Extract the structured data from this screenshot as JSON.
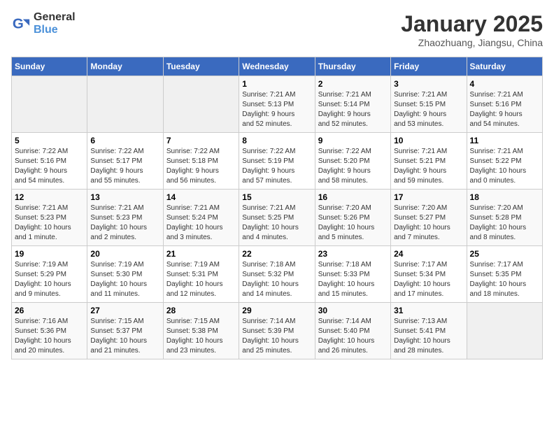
{
  "logo": {
    "line1": "General",
    "line2": "Blue"
  },
  "title": "January 2025",
  "subtitle": "Zhaozhuang, Jiangsu, China",
  "days_of_week": [
    "Sunday",
    "Monday",
    "Tuesday",
    "Wednesday",
    "Thursday",
    "Friday",
    "Saturday"
  ],
  "weeks": [
    [
      {
        "num": "",
        "info": ""
      },
      {
        "num": "",
        "info": ""
      },
      {
        "num": "",
        "info": ""
      },
      {
        "num": "1",
        "info": "Sunrise: 7:21 AM\nSunset: 5:13 PM\nDaylight: 9 hours\nand 52 minutes."
      },
      {
        "num": "2",
        "info": "Sunrise: 7:21 AM\nSunset: 5:14 PM\nDaylight: 9 hours\nand 52 minutes."
      },
      {
        "num": "3",
        "info": "Sunrise: 7:21 AM\nSunset: 5:15 PM\nDaylight: 9 hours\nand 53 minutes."
      },
      {
        "num": "4",
        "info": "Sunrise: 7:21 AM\nSunset: 5:16 PM\nDaylight: 9 hours\nand 54 minutes."
      }
    ],
    [
      {
        "num": "5",
        "info": "Sunrise: 7:22 AM\nSunset: 5:16 PM\nDaylight: 9 hours\nand 54 minutes."
      },
      {
        "num": "6",
        "info": "Sunrise: 7:22 AM\nSunset: 5:17 PM\nDaylight: 9 hours\nand 55 minutes."
      },
      {
        "num": "7",
        "info": "Sunrise: 7:22 AM\nSunset: 5:18 PM\nDaylight: 9 hours\nand 56 minutes."
      },
      {
        "num": "8",
        "info": "Sunrise: 7:22 AM\nSunset: 5:19 PM\nDaylight: 9 hours\nand 57 minutes."
      },
      {
        "num": "9",
        "info": "Sunrise: 7:22 AM\nSunset: 5:20 PM\nDaylight: 9 hours\nand 58 minutes."
      },
      {
        "num": "10",
        "info": "Sunrise: 7:21 AM\nSunset: 5:21 PM\nDaylight: 9 hours\nand 59 minutes."
      },
      {
        "num": "11",
        "info": "Sunrise: 7:21 AM\nSunset: 5:22 PM\nDaylight: 10 hours\nand 0 minutes."
      }
    ],
    [
      {
        "num": "12",
        "info": "Sunrise: 7:21 AM\nSunset: 5:23 PM\nDaylight: 10 hours\nand 1 minute."
      },
      {
        "num": "13",
        "info": "Sunrise: 7:21 AM\nSunset: 5:23 PM\nDaylight: 10 hours\nand 2 minutes."
      },
      {
        "num": "14",
        "info": "Sunrise: 7:21 AM\nSunset: 5:24 PM\nDaylight: 10 hours\nand 3 minutes."
      },
      {
        "num": "15",
        "info": "Sunrise: 7:21 AM\nSunset: 5:25 PM\nDaylight: 10 hours\nand 4 minutes."
      },
      {
        "num": "16",
        "info": "Sunrise: 7:20 AM\nSunset: 5:26 PM\nDaylight: 10 hours\nand 5 minutes."
      },
      {
        "num": "17",
        "info": "Sunrise: 7:20 AM\nSunset: 5:27 PM\nDaylight: 10 hours\nand 7 minutes."
      },
      {
        "num": "18",
        "info": "Sunrise: 7:20 AM\nSunset: 5:28 PM\nDaylight: 10 hours\nand 8 minutes."
      }
    ],
    [
      {
        "num": "19",
        "info": "Sunrise: 7:19 AM\nSunset: 5:29 PM\nDaylight: 10 hours\nand 9 minutes."
      },
      {
        "num": "20",
        "info": "Sunrise: 7:19 AM\nSunset: 5:30 PM\nDaylight: 10 hours\nand 11 minutes."
      },
      {
        "num": "21",
        "info": "Sunrise: 7:19 AM\nSunset: 5:31 PM\nDaylight: 10 hours\nand 12 minutes."
      },
      {
        "num": "22",
        "info": "Sunrise: 7:18 AM\nSunset: 5:32 PM\nDaylight: 10 hours\nand 14 minutes."
      },
      {
        "num": "23",
        "info": "Sunrise: 7:18 AM\nSunset: 5:33 PM\nDaylight: 10 hours\nand 15 minutes."
      },
      {
        "num": "24",
        "info": "Sunrise: 7:17 AM\nSunset: 5:34 PM\nDaylight: 10 hours\nand 17 minutes."
      },
      {
        "num": "25",
        "info": "Sunrise: 7:17 AM\nSunset: 5:35 PM\nDaylight: 10 hours\nand 18 minutes."
      }
    ],
    [
      {
        "num": "26",
        "info": "Sunrise: 7:16 AM\nSunset: 5:36 PM\nDaylight: 10 hours\nand 20 minutes."
      },
      {
        "num": "27",
        "info": "Sunrise: 7:15 AM\nSunset: 5:37 PM\nDaylight: 10 hours\nand 21 minutes."
      },
      {
        "num": "28",
        "info": "Sunrise: 7:15 AM\nSunset: 5:38 PM\nDaylight: 10 hours\nand 23 minutes."
      },
      {
        "num": "29",
        "info": "Sunrise: 7:14 AM\nSunset: 5:39 PM\nDaylight: 10 hours\nand 25 minutes."
      },
      {
        "num": "30",
        "info": "Sunrise: 7:14 AM\nSunset: 5:40 PM\nDaylight: 10 hours\nand 26 minutes."
      },
      {
        "num": "31",
        "info": "Sunrise: 7:13 AM\nSunset: 5:41 PM\nDaylight: 10 hours\nand 28 minutes."
      },
      {
        "num": "",
        "info": ""
      }
    ]
  ]
}
